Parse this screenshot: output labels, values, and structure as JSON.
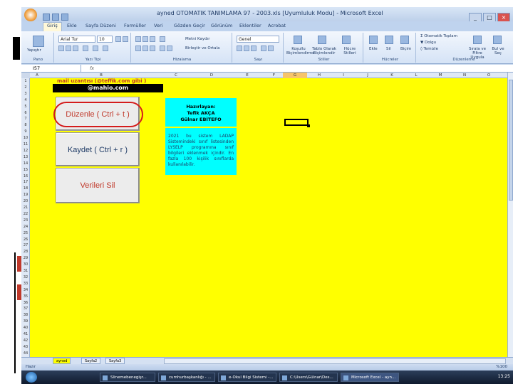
{
  "window": {
    "title": "ayned OTOMATIK TANIMLAMA 97 - 2003.xls [Uyumluluk Modu] - Microsoft Excel"
  },
  "ribbon_tabs": [
    "Giriş",
    "Ekle",
    "Sayfa Düzeni",
    "Formüller",
    "Veri",
    "Gözden Geçir",
    "Görünüm",
    "Eklentiler",
    "Acrobat"
  ],
  "ribbon": {
    "groups": {
      "clipboard": "Pano",
      "font": "Yazı Tipi",
      "alignment": "Hizalama",
      "number": "Sayı",
      "styles": "Stiller",
      "cells": "Hücreler",
      "editing": "Düzenleme"
    },
    "paste": "Yapıştır",
    "font_name": "Arial Tur",
    "font_size": "10",
    "wrap_text": "Metni Kaydır",
    "merge_center": "Birleştir ve Ortala",
    "number_format": "Genel",
    "cond_format": "Koşullu Biçimlendirme",
    "format_table": "Tablo Olarak Biçimlendir",
    "cell_styles": "Hücre Stilleri",
    "insert": "Ekle",
    "delete": "Sil",
    "format": "Biçim",
    "autosum": "Otomatik Toplam",
    "fill": "Dolgu",
    "clear": "Temizle",
    "sort_filter": "Sırala ve Filtre Uygula",
    "find_select": "Bul ve Seç"
  },
  "formula_bar": {
    "name_box": "I57",
    "fx": "fx"
  },
  "columns": [
    "A",
    "B",
    "C",
    "D",
    "E",
    "F",
    "G",
    "H",
    "I",
    "J",
    "K",
    "L",
    "M",
    "N",
    "O"
  ],
  "rows": [
    "1",
    "2",
    "3",
    "4",
    "5",
    "6",
    "7",
    "8",
    "9",
    "10",
    "11",
    "12",
    "13",
    "14",
    "15",
    "16",
    "17",
    "18",
    "19",
    "20",
    "21",
    "22",
    "23",
    "24",
    "25",
    "26",
    "27",
    "28",
    "29",
    "30",
    "31",
    "32",
    "33",
    "34",
    "35",
    "36",
    "37",
    "38",
    "39",
    "40",
    "41",
    "42",
    "43",
    "44"
  ],
  "sheet": {
    "mail_label": "mail uzantısı (@teffik.com gibi )",
    "mail_value": "@mahio.com",
    "buttons": {
      "edit": "Düzenle  ( Ctrl + t )",
      "save": "Kaydet ( Ctrl + r )",
      "delete": "Verileri Sil"
    },
    "info_box": {
      "line1": "Hazırlayan:",
      "line2": "Tefik AKÇA",
      "line3": "Gülnar EBİTEFO"
    },
    "desc_box": "2021 bu sistem LADAP Sistemindeki sınıf listesinden LYSELP programına sınıf bilgileri eklenmek içindir. En fazla 100 kişilik sınıflarda kullanılabilir."
  },
  "sheet_tabs": [
    "ayned",
    "Sayfa2",
    "Sayfa3"
  ],
  "status": {
    "left": "Hazır",
    "zoom": "%100"
  },
  "taskbar": {
    "items": [
      "Slinemebenegişr...",
      "cumhurbaşkanlığı - ...",
      "e-Okul Bilgi Sistemi -...",
      "C:\\Users\\Gülnar\\Des...",
      "Microsoft Excel - ayn..."
    ],
    "clock": "13:25"
  },
  "colors": {
    "sheet_bg": "#ffff00",
    "info_bg": "#00ffff",
    "highlight_oval": "#d41c1c"
  }
}
